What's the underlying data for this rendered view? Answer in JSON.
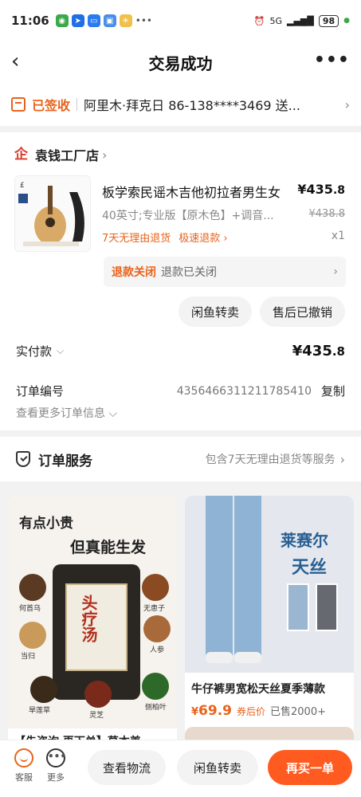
{
  "status_bar": {
    "time": "11:06",
    "network": "5G",
    "battery": "98"
  },
  "nav": {
    "title": "交易成功",
    "more": "•••"
  },
  "address": {
    "status": "已签收",
    "text": "阿里木·拜克日  86-138****3469  送..."
  },
  "shop": {
    "name": "袁钱工厂店"
  },
  "product": {
    "title": "板学索民谣木吉他初拉者男生女",
    "price_main": "¥435",
    "price_dec": ".8",
    "spec": "40英寸;专业版【原木色】+调音...",
    "original_price": "¥438.8",
    "tag1": "7天无理由退货",
    "tag2": "极速退款 ›",
    "qty": "x1"
  },
  "refund": {
    "status": "退款关闭",
    "desc": "退款已关闭"
  },
  "buttons": {
    "resell": "闲鱼转卖",
    "after_sale": "售后已撤销"
  },
  "paid": {
    "label": "实付款",
    "amount_main": "¥435",
    "amount_dec": ".8"
  },
  "order": {
    "label": "订单编号",
    "number": "4356466311211785410",
    "copy": "复制",
    "more_info": "查看更多订单信息"
  },
  "service": {
    "title": "订单服务",
    "desc": "包含7天无理由退货等服务"
  },
  "recommendations": {
    "left": {
      "headline1": "有点小贵",
      "headline2": "但真能生发",
      "pack_label": "头疗汤",
      "herbs": [
        "何首乌",
        "无患子",
        "人参",
        "当归",
        "灵芝",
        "侧柏叶",
        "旱莲草"
      ],
      "title": "【先咨询 再下单】草本姜"
    },
    "right": {
      "brand1": "莱赛尔",
      "brand2": "天丝",
      "title": "牛仔裤男宽松天丝夏季薄款",
      "currency": "¥",
      "price": "69.9",
      "price_tag": "券后价",
      "sold": "已售2000+"
    }
  },
  "bottom_bar": {
    "service_label": "客服",
    "more_label": "更多",
    "logistics": "查看物流",
    "xianyu": "闲鱼转卖",
    "rebuy": "再买一单"
  },
  "colors": {
    "accent": "#e8631c",
    "primary_button": "#ff5a1f"
  }
}
